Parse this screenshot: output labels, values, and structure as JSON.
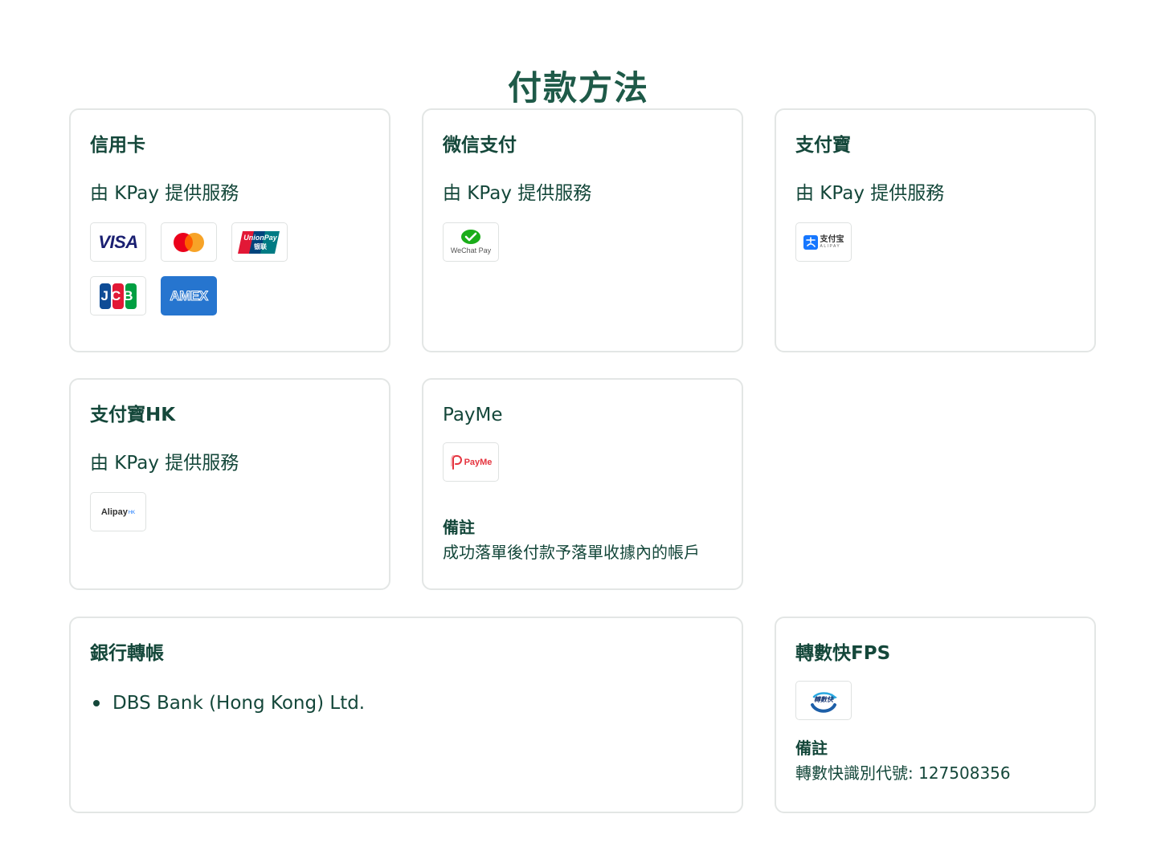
{
  "page_title": "付款方法",
  "cards": {
    "credit_card": {
      "title": "信用卡",
      "provider": "由 KPay 提供服務",
      "logos": {
        "visa": "VISA",
        "unionpay_top": "UnionPay",
        "unionpay_bottom": "银联",
        "jcb": "JCB",
        "amex": "AMEX"
      }
    },
    "wechat_pay": {
      "title": "微信支付",
      "provider": "由 KPay 提供服務",
      "logo_text": "WeChat Pay"
    },
    "alipay": {
      "title": "支付寶",
      "provider": "由 KPay 提供服務",
      "logo_cn": "支付宝",
      "logo_en": "ALIPAY"
    },
    "alipay_hk": {
      "title": "支付寶HK",
      "provider": "由 KPay 提供服務",
      "logo_text": "Alipay",
      "logo_suffix": "HK"
    },
    "payme": {
      "title": "PayMe",
      "logo_text": "PayMe",
      "note_label": "備註",
      "note_text": "成功落單後付款予落單收據內的帳戶"
    },
    "bank_transfer": {
      "title": "銀行轉帳",
      "banks": [
        "DBS Bank (Hong Kong) Ltd."
      ]
    },
    "fps": {
      "title": "轉數快FPS",
      "logo_text": "轉數快",
      "note_label": "備註",
      "note_text": "轉數快識別代號: 127508356"
    }
  },
  "colors": {
    "heading": "#1e5a48",
    "text": "#14473a",
    "card_border": "#e3e6e5",
    "visa_blue": "#1a1f71",
    "mastercard_red": "#eb001b",
    "mastercard_orange": "#f79e1b",
    "amex_blue": "#2675cf",
    "wechat_green": "#1aad19",
    "alipay_blue": "#1677ff",
    "payme_red": "#e5343f",
    "fps_blue": "#1d5fa8"
  }
}
